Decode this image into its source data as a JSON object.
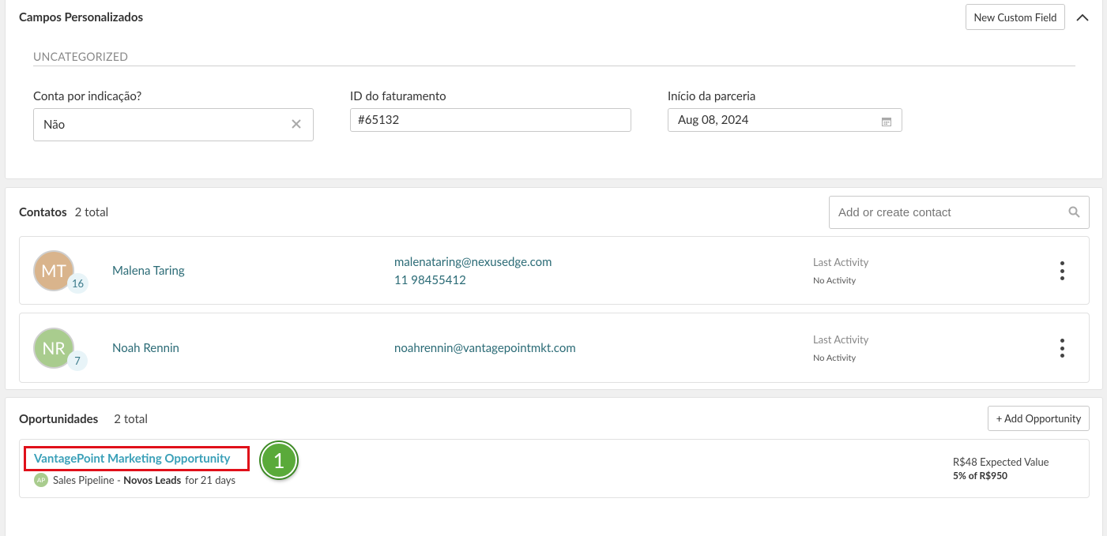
{
  "custom_fields": {
    "title": "Campos Personalizados",
    "new_button": "New Custom Field",
    "category": "UNCATEGORIZED",
    "fields": [
      {
        "label": "Conta por indicação?",
        "value": "Não"
      },
      {
        "label": "ID do faturamento",
        "value": "#65132"
      },
      {
        "label": "Início da parceria",
        "value": "Aug 08, 2024"
      }
    ]
  },
  "contacts": {
    "title": "Contatos",
    "count": "2 total",
    "search_placeholder": "Add or create contact",
    "items": [
      {
        "initials": "MT",
        "color": "#d9b48c",
        "badge": "16",
        "name": "Malena Taring",
        "email": "malenataring@nexusedge.com",
        "phone": "11 98455412",
        "last_activity_label": "Last Activity",
        "last_activity_value": "No Activity"
      },
      {
        "initials": "NR",
        "color": "#a9cc8e",
        "badge": "7",
        "name": "Noah Rennin",
        "email": "noahrennin@vantagepointmkt.com",
        "phone": "",
        "last_activity_label": "Last Activity",
        "last_activity_value": "No Activity"
      }
    ]
  },
  "opportunities": {
    "title": "Oportunidades",
    "count": "2 total",
    "add_button": "+ Add Opportunity",
    "items": [
      {
        "name": "VantagePoint Marketing Opportunity",
        "owner_initials": "AP",
        "pipeline": "Sales Pipeline",
        "separator": " - ",
        "stage": "Novos Leads",
        "duration": "for 21 days",
        "expected_value": "R$48 Expected Value",
        "probability": "5% of R$950"
      }
    ],
    "callout_number": "1"
  },
  "colors": {
    "teal": "#2b6b76",
    "highlight": "#e0101a",
    "callout": "#5aaa3a"
  }
}
